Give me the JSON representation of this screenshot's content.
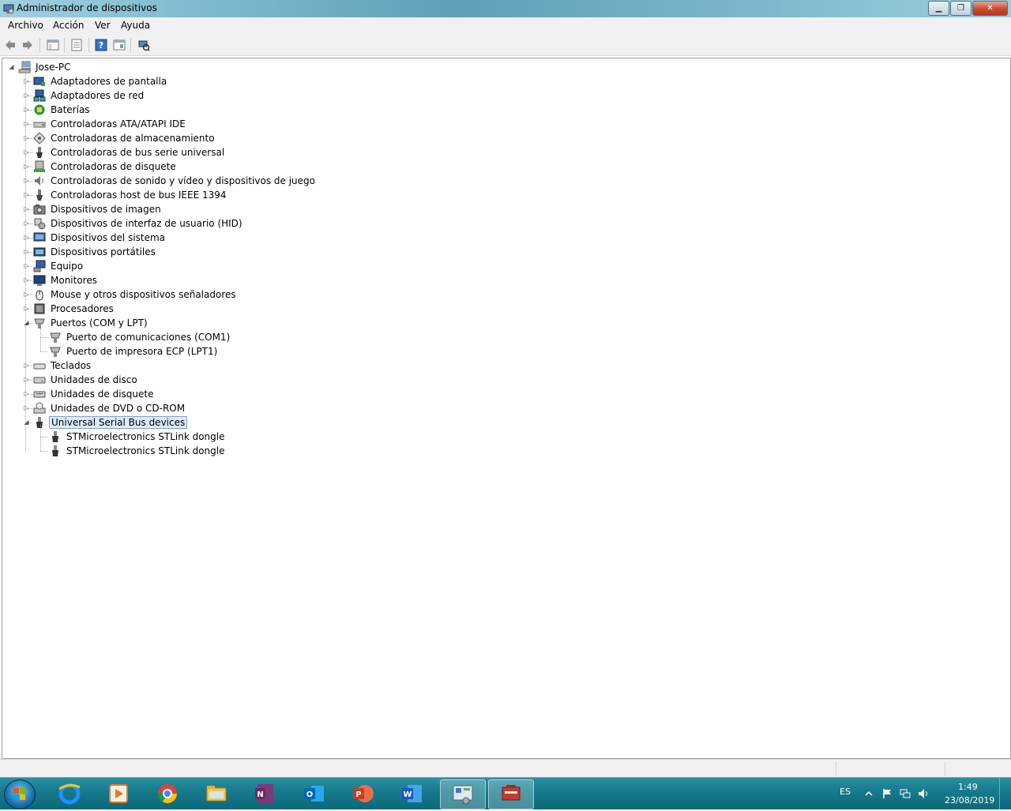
{
  "window": {
    "title": "Administrador de dispositivos"
  },
  "menu": [
    "Archivo",
    "Acción",
    "Ver",
    "Ayuda"
  ],
  "toolbar": [
    "back-icon",
    "forward-icon",
    "properties-view-icon",
    "list-view-icon",
    "help-icon",
    "console-tree-icon",
    "scan-hardware-icon"
  ],
  "tree": {
    "root": "Jose-PC",
    "categories": [
      {
        "label": "Adaptadores de pantalla",
        "icon": "display-adapter-icon",
        "expanded": false
      },
      {
        "label": "Adaptadores de red",
        "icon": "network-adapter-icon",
        "expanded": false
      },
      {
        "label": "Baterías",
        "icon": "battery-icon",
        "expanded": false
      },
      {
        "label": "Controladoras ATA/ATAPI IDE",
        "icon": "ide-controller-icon",
        "expanded": false
      },
      {
        "label": "Controladoras de almacenamiento",
        "icon": "storage-controller-icon",
        "expanded": false
      },
      {
        "label": "Controladoras de bus serie universal",
        "icon": "usb-controller-icon",
        "expanded": false
      },
      {
        "label": "Controladoras de disquete",
        "icon": "floppy-controller-icon",
        "expanded": false
      },
      {
        "label": "Controladoras de sonido y vídeo y dispositivos de juego",
        "icon": "sound-icon",
        "expanded": false
      },
      {
        "label": "Controladoras host de bus IEEE 1394",
        "icon": "ieee1394-icon",
        "expanded": false
      },
      {
        "label": "Dispositivos de imagen",
        "icon": "imaging-device-icon",
        "expanded": false
      },
      {
        "label": "Dispositivos de interfaz de usuario (HID)",
        "icon": "hid-icon",
        "expanded": false
      },
      {
        "label": "Dispositivos del sistema",
        "icon": "system-device-icon",
        "expanded": false
      },
      {
        "label": "Dispositivos portátiles",
        "icon": "portable-device-icon",
        "expanded": false
      },
      {
        "label": "Equipo",
        "icon": "computer-icon",
        "expanded": false
      },
      {
        "label": "Monitores",
        "icon": "monitor-icon",
        "expanded": false
      },
      {
        "label": "Mouse y otros dispositivos señaladores",
        "icon": "mouse-icon",
        "expanded": false
      },
      {
        "label": "Procesadores",
        "icon": "processor-icon",
        "expanded": false
      },
      {
        "label": "Puertos (COM y LPT)",
        "icon": "port-icon",
        "expanded": true,
        "children": [
          "Puerto de comunicaciones (COM1)",
          "Puerto de impresora ECP (LPT1)"
        ]
      },
      {
        "label": "Teclados",
        "icon": "keyboard-icon",
        "expanded": false
      },
      {
        "label": "Unidades de disco",
        "icon": "disk-drive-icon",
        "expanded": false
      },
      {
        "label": "Unidades de disquete",
        "icon": "floppy-drive-icon",
        "expanded": false
      },
      {
        "label": "Unidades de DVD o CD-ROM",
        "icon": "dvd-drive-icon",
        "expanded": false
      },
      {
        "label": "Universal Serial Bus devices",
        "icon": "usb-device-icon",
        "expanded": true,
        "selected": true,
        "children": [
          "STMicroelectronics STLink dongle",
          "STMicroelectronics STLink dongle"
        ]
      }
    ]
  },
  "taskbar": {
    "apps": [
      "internet-explorer-icon",
      "media-player-icon",
      "chrome-icon",
      "file-explorer-icon",
      "onenote-icon",
      "outlook-icon",
      "powerpoint-icon",
      "word-icon",
      "control-panel-icon",
      "device-manager-icon"
    ],
    "language": "ES",
    "time": "1:49",
    "date": "23/08/2019"
  }
}
